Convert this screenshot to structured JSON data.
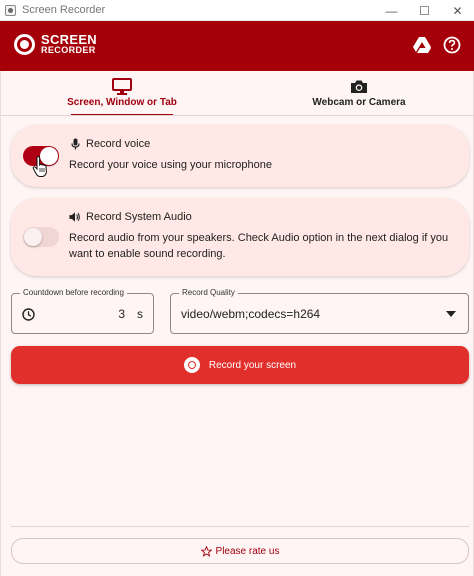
{
  "window": {
    "title": "Screen Recorder",
    "minimize_glyph": "—",
    "maximize_glyph": "☐",
    "close_glyph": "✕"
  },
  "header": {
    "logo_line1": "SCREEN",
    "logo_line2": "RECORDER",
    "icons": [
      "google-drive-icon",
      "help-icon"
    ],
    "brand_color": "#a50009"
  },
  "tabs": [
    {
      "label": "Screen, Window or Tab",
      "icon": "monitor-icon",
      "active": true
    },
    {
      "label": "Webcam or Camera",
      "icon": "camera-icon",
      "active": false
    }
  ],
  "options": {
    "voice": {
      "title": "Record voice",
      "description": "Record your voice using your microphone",
      "icon": "microphone-icon",
      "enabled": true
    },
    "system_audio": {
      "title": "Record System Audio",
      "description": "Record audio from your speakers. Check Audio option in the next dialog if you want to enable sound recording.",
      "icon": "speaker-icon",
      "enabled": false
    }
  },
  "countdown": {
    "label": "Countdown before recording",
    "value": "3",
    "unit": "s"
  },
  "quality": {
    "label": "Record Quality",
    "value": "video/webm;codecs=h264"
  },
  "record_button": {
    "label": "Record your screen",
    "color": "#e12f2b"
  },
  "rate_button": {
    "label": "Please rate us"
  }
}
